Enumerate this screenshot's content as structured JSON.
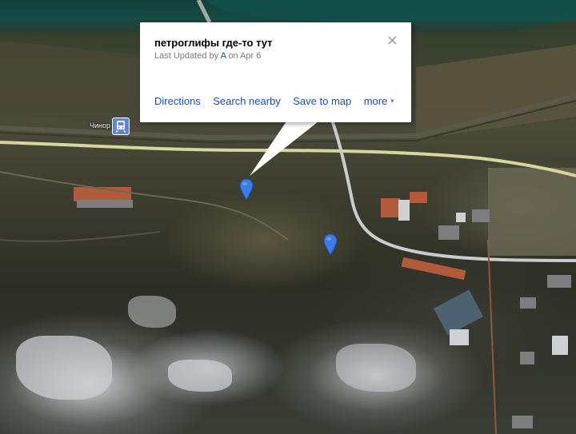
{
  "info_window": {
    "title": "петроглифы где-то тут",
    "updated_prefix": "Last Updated by ",
    "updated_author": "A",
    "updated_suffix": " on Apr 6",
    "close_label": "×",
    "actions": {
      "directions": "Directions",
      "search_nearby": "Search nearby",
      "save_to_map": "Save to map",
      "more": "more"
    }
  },
  "map": {
    "type": "satellite",
    "station_label": "Чинор",
    "colors": {
      "road_main": "#d8d6a0",
      "road_secondary": "#c8cdd0",
      "pin": "#3d7be8",
      "link": "#1a4ea8",
      "water": "#164a45"
    }
  },
  "markers": [
    {
      "icon": "map-pin-icon"
    },
    {
      "icon": "map-pin-icon"
    }
  ]
}
